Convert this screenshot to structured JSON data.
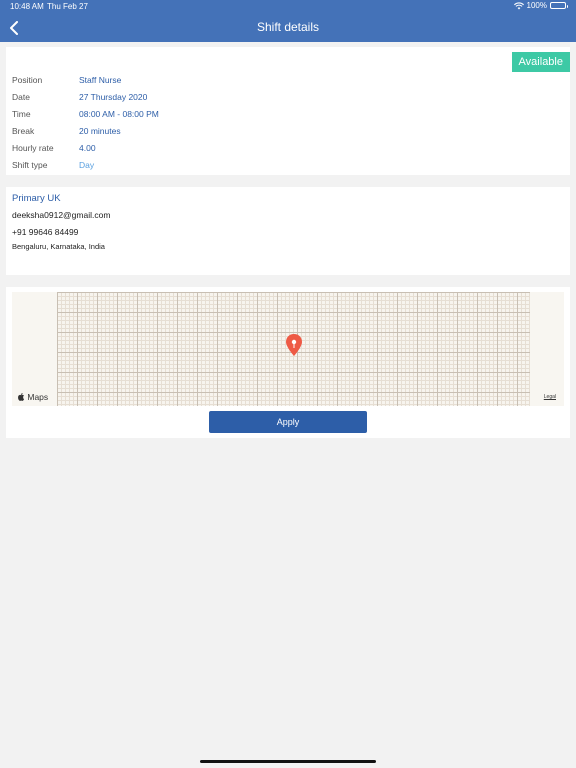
{
  "status_bar": {
    "time": "10:48 AM",
    "date": "Thu Feb 27",
    "battery": "100%"
  },
  "nav": {
    "title": "Shift details"
  },
  "shift": {
    "status": "Available",
    "rows": [
      {
        "label": "Position",
        "value": "Staff Nurse"
      },
      {
        "label": "Date",
        "value": "27 Thursday 2020"
      },
      {
        "label": "Time",
        "value": "08:00 AM - 08:00 PM"
      },
      {
        "label": "Break",
        "value": "20 minutes"
      },
      {
        "label": "Hourly rate",
        "value": "4.00"
      },
      {
        "label": "Shift type",
        "value": "Day"
      }
    ]
  },
  "employer": {
    "name": "Primary UK",
    "email": "deeksha0912@gmail.com",
    "phone": "+91 99646 84499",
    "address": "Bengaluru, Karnataka, India"
  },
  "map": {
    "logo": "Maps",
    "legal": "Legal",
    "pin_color": "#ee5a45"
  },
  "actions": {
    "apply_label": "Apply"
  },
  "colors": {
    "header": "#4472b8",
    "accent": "#2d5ea8",
    "badge": "#3dc9a5"
  }
}
